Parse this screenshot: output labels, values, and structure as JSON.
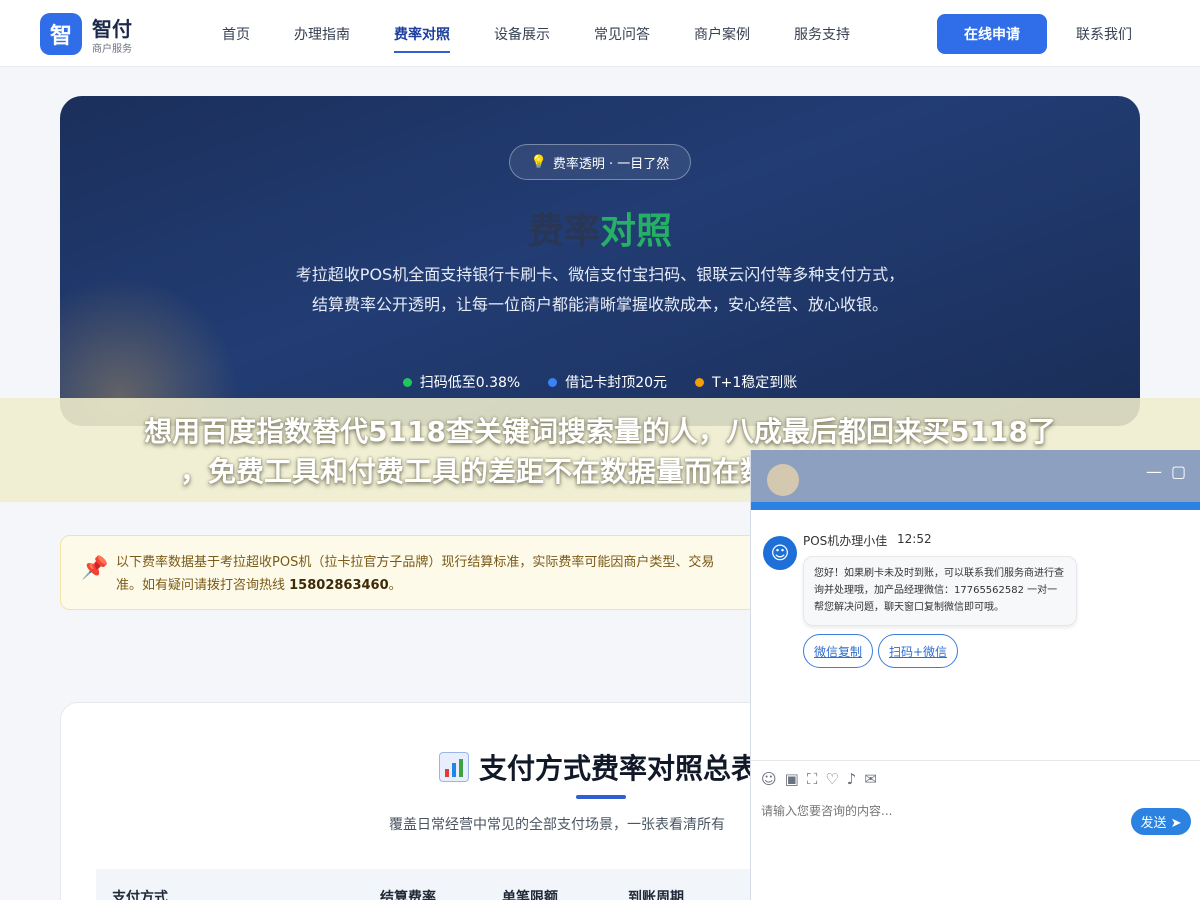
{
  "header": {
    "logo_mark": "智",
    "logo_title": "智付",
    "logo_subtitle": "商户服务",
    "nav": [
      {
        "label": "首页",
        "active": false
      },
      {
        "label": "办理指南",
        "active": false
      },
      {
        "label": "费率对照",
        "active": true
      },
      {
        "label": "设备展示",
        "active": false
      },
      {
        "label": "常见问答",
        "active": false
      },
      {
        "label": "商户案例",
        "active": false
      },
      {
        "label": "服务支持",
        "active": false
      }
    ],
    "apply_label": "在线申请",
    "contact_label": "联系我们"
  },
  "hero": {
    "pill_icon": "lightbulb-icon",
    "pill_text": "费率透明 · 一目了然",
    "title_part1": "费率",
    "title_part2": "对照",
    "description": "考拉超收POS机全面支持银行卡刷卡、微信支付宝扫码、银联云闪付等多种支付方式，结算费率公开透明，让每一位商户都能清晰掌握收款成本，安心经营、放心收银。",
    "features": [
      {
        "text": "扫码低至0.38%",
        "color": "#22c55e"
      },
      {
        "text": "借记卡封顶20元",
        "color": "#3b82f6"
      },
      {
        "text": "T+1稳定到账",
        "color": "#f59e0b"
      }
    ]
  },
  "overlay": {
    "line1": "想用百度指数替代5118查关键词搜索量的人，八成最后都回来买5118了",
    "line2": "，免费工具和付费工具的差距不在数据量而在数据能直接拿来干什么"
  },
  "notice": {
    "icon": "pushpin-icon",
    "text_prefix": "以下费率数据基于考拉超收POS机（拉卡拉官方子品牌）现行结算标准，实际费率可能因商户类型、交易",
    "text_line2": "准。如有疑问请拨打咨询热线 ",
    "hotline": "15802863460",
    "text_end": "。"
  },
  "summary": {
    "icon": "bar-chart-icon",
    "title": "支付方式费率对照总表",
    "subtitle": "覆盖日常经营中常见的全部支付场景，一张表看清所有",
    "columns": [
      "支付方式",
      "结算费率",
      "单笔限额",
      "到账周期"
    ]
  },
  "chat": {
    "agent_avatar": "agent-avatar-icon",
    "agent_name": "POS机办理小佳",
    "time": "12:52",
    "message": "您好！如果刷卡未及时到账，可以联系我们服务商进行查询并处理哦，加产品经理微信：17765562582 一对一帮您解决问题，聊天窗口复制微信即可哦。",
    "quick_buttons": [
      "微信复制",
      "扫码+微信"
    ],
    "input_placeholder": "请输入您要咨询的内容...",
    "send_label": "发送",
    "tools": [
      "emoji-icon",
      "image-icon",
      "screenshot-icon",
      "rating-icon",
      "voice-icon",
      "comment-icon"
    ],
    "minimize_icon": "minimize-icon",
    "close_icon": "window-icon"
  }
}
